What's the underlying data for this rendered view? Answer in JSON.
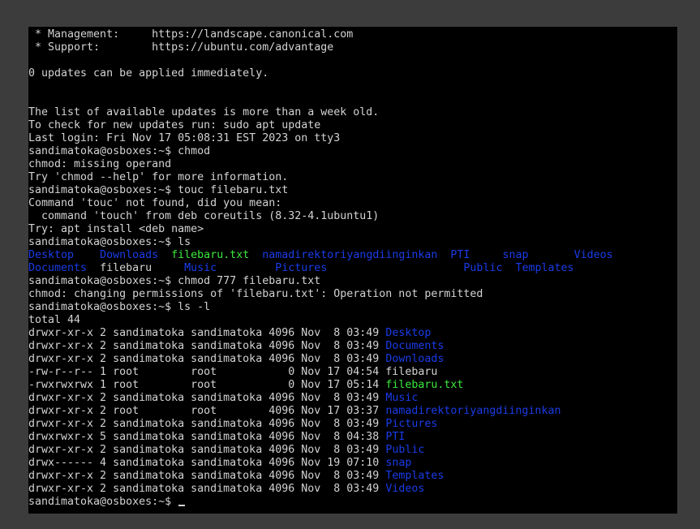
{
  "terminal": {
    "colors": {
      "background": "#000000",
      "foreground": "#d3d3d3",
      "directory": "#1a3ce8",
      "executable": "#3ce83c"
    },
    "lines": [
      [
        {
          "t": " * Management:     https://landscape.canonical.com"
        }
      ],
      [
        {
          "t": " * Support:        https://ubuntu.com/advantage"
        }
      ],
      [
        {
          "t": ""
        }
      ],
      [
        {
          "t": "0 updates can be applied immediately."
        }
      ],
      [
        {
          "t": ""
        }
      ],
      [
        {
          "t": ""
        }
      ],
      [
        {
          "t": "The list of available updates is more than a week old."
        }
      ],
      [
        {
          "t": "To check for new updates run: sudo apt update"
        }
      ],
      [
        {
          "t": "Last login: Fri Nov 17 05:08:31 EST 2023 on tty3"
        }
      ],
      [
        {
          "t": "sandimatoka@osboxes:~$ chmod"
        }
      ],
      [
        {
          "t": "chmod: missing operand"
        }
      ],
      [
        {
          "t": "Try 'chmod --help' for more information."
        }
      ],
      [
        {
          "t": "sandimatoka@osboxes:~$ touc filebaru.txt"
        }
      ],
      [
        {
          "t": "Command 'touc' not found, did you mean:"
        }
      ],
      [
        {
          "t": "  command 'touch' from deb coreutils (8.32-4.1ubuntu1)"
        }
      ],
      [
        {
          "t": "Try: apt install <deb name>"
        }
      ],
      [
        {
          "t": "sandimatoka@osboxes:~$ ls"
        }
      ],
      [
        {
          "t": "Desktop",
          "c": "blue"
        },
        {
          "t": "    "
        },
        {
          "t": "Downloads",
          "c": "blue"
        },
        {
          "t": "  "
        },
        {
          "t": "filebaru.txt",
          "c": "green"
        },
        {
          "t": "  "
        },
        {
          "t": "namadirektoriyangdiinginkan",
          "c": "blue"
        },
        {
          "t": "  "
        },
        {
          "t": "PTI",
          "c": "blue"
        },
        {
          "t": "     "
        },
        {
          "t": "snap",
          "c": "blue"
        },
        {
          "t": "       "
        },
        {
          "t": "Videos",
          "c": "blue"
        }
      ],
      [
        {
          "t": "Documents",
          "c": "blue"
        },
        {
          "t": "  filebaru     "
        },
        {
          "t": "Music",
          "c": "blue"
        },
        {
          "t": "         "
        },
        {
          "t": "Pictures",
          "c": "blue"
        },
        {
          "t": "                     "
        },
        {
          "t": "Public",
          "c": "blue"
        },
        {
          "t": "  "
        },
        {
          "t": "Templates",
          "c": "blue"
        }
      ],
      [
        {
          "t": "sandimatoka@osboxes:~$ chmod 777 filebaru.txt"
        }
      ],
      [
        {
          "t": "chmod: changing permissions of 'filebaru.txt': Operation not permitted"
        }
      ],
      [
        {
          "t": "sandimatoka@osboxes:~$ ls -l"
        }
      ],
      [
        {
          "t": "total 44"
        }
      ],
      [
        {
          "t": "drwxr-xr-x 2 sandimatoka sandimatoka 4096 Nov  8 03:49 "
        },
        {
          "t": "Desktop",
          "c": "blue"
        }
      ],
      [
        {
          "t": "drwxr-xr-x 2 sandimatoka sandimatoka 4096 Nov  8 03:49 "
        },
        {
          "t": "Documents",
          "c": "blue"
        }
      ],
      [
        {
          "t": "drwxr-xr-x 2 sandimatoka sandimatoka 4096 Nov  8 03:49 "
        },
        {
          "t": "Downloads",
          "c": "blue"
        }
      ],
      [
        {
          "t": "-rw-r--r-- 1 root        root           0 Nov 17 04:54 filebaru"
        }
      ],
      [
        {
          "t": "-rwxrwxrwx 1 root        root           0 Nov 17 05:14 "
        },
        {
          "t": "filebaru.txt",
          "c": "green"
        }
      ],
      [
        {
          "t": "drwxr-xr-x 2 sandimatoka sandimatoka 4096 Nov  8 03:49 "
        },
        {
          "t": "Music",
          "c": "blue"
        }
      ],
      [
        {
          "t": "drwxr-xr-x 2 root        root        4096 Nov 17 03:37 "
        },
        {
          "t": "namadirektoriyangdiinginkan",
          "c": "blue"
        }
      ],
      [
        {
          "t": "drwxr-xr-x 2 sandimatoka sandimatoka 4096 Nov  8 03:49 "
        },
        {
          "t": "Pictures",
          "c": "blue"
        }
      ],
      [
        {
          "t": "drwxrwxr-x 5 sandimatoka sandimatoka 4096 Nov  8 04:38 "
        },
        {
          "t": "PTI",
          "c": "blue"
        }
      ],
      [
        {
          "t": "drwxr-xr-x 2 sandimatoka sandimatoka 4096 Nov  8 03:49 "
        },
        {
          "t": "Public",
          "c": "blue"
        }
      ],
      [
        {
          "t": "drwx------ 4 sandimatoka sandimatoka 4096 Nov 19 07:10 "
        },
        {
          "t": "snap",
          "c": "blue"
        }
      ],
      [
        {
          "t": "drwxr-xr-x 2 sandimatoka sandimatoka 4096 Nov  8 03:49 "
        },
        {
          "t": "Templates",
          "c": "blue"
        }
      ],
      [
        {
          "t": "drwxr-xr-x 2 sandimatoka sandimatoka 4096 Nov  8 03:49 "
        },
        {
          "t": "Videos",
          "c": "blue"
        }
      ]
    ],
    "prompt": "sandimatoka@osboxes:~$ "
  }
}
